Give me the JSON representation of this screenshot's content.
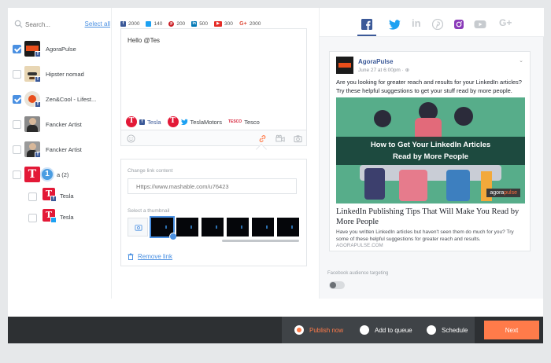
{
  "close_glyph": "×",
  "search": {
    "placeholder": "Search..."
  },
  "select_all_label": "Select all",
  "accounts": [
    {
      "name": "AgoraPulse",
      "checked": true
    },
    {
      "name": "Hipster nomad",
      "checked": false
    },
    {
      "name": "Zen&Cool - Lifest...",
      "checked": true
    },
    {
      "name": "Fancker Artist",
      "checked": false
    },
    {
      "name": "Fancker Artist",
      "checked": false
    },
    {
      "name": "a (2)",
      "checked": false,
      "badge": "1"
    },
    {
      "name": "Tesla",
      "checked": false
    },
    {
      "name": "Tesla",
      "checked": false
    }
  ],
  "stats": [
    {
      "network": "facebook",
      "value": "2000",
      "color": "#3b5998"
    },
    {
      "network": "twitter",
      "value": "140",
      "color": "#1da1f2"
    },
    {
      "network": "pinterest",
      "value": "200",
      "color": "#cb2027"
    },
    {
      "network": "linkedin",
      "value": "500",
      "color": "#0077b5"
    },
    {
      "network": "youtube",
      "value": "300",
      "color": "#e52d27"
    },
    {
      "network": "google-plus",
      "value": "2000",
      "color": "#dd4b39"
    }
  ],
  "compose": {
    "text": "Hello @Tes",
    "mentions": [
      "Tesla",
      "TeslaMotors",
      "Tesco"
    ]
  },
  "link_panel": {
    "change_label": "Change link content",
    "url_placeholder": "Https://www.mashable.com/u76423",
    "thumbnail_label": "Select a thumbnail",
    "remove_label": "Remove link"
  },
  "preview": {
    "page_name": "AgoraPulse",
    "date": "June 27 at 6:00pm · ⊕",
    "text": "Are you looking for greater reach and results for your LinkedIn articles? Try these helpful suggestions to get your stuff read by more people.",
    "image_title_1": "How to Get Your LinkedIn Articles",
    "image_title_2": "Read by More People",
    "image_logo_a": "agora",
    "image_logo_b": "pulse",
    "link_title": "LinkedIn Publishing Tips That Will Make You Read by More People",
    "link_desc": "Have you written LinkedIn articles but haven't seen them do much for you? Try some of these helpful suggestions for greater reach and results.",
    "domain": "AGORAPULSE.COM"
  },
  "targeting_label": "Facebook audience targeting",
  "footer": {
    "publish_now": "Publish now",
    "add_to_queue": "Add to queue",
    "schedule": "Schedule",
    "next": "Next",
    "accent": "#ff7b4a"
  }
}
